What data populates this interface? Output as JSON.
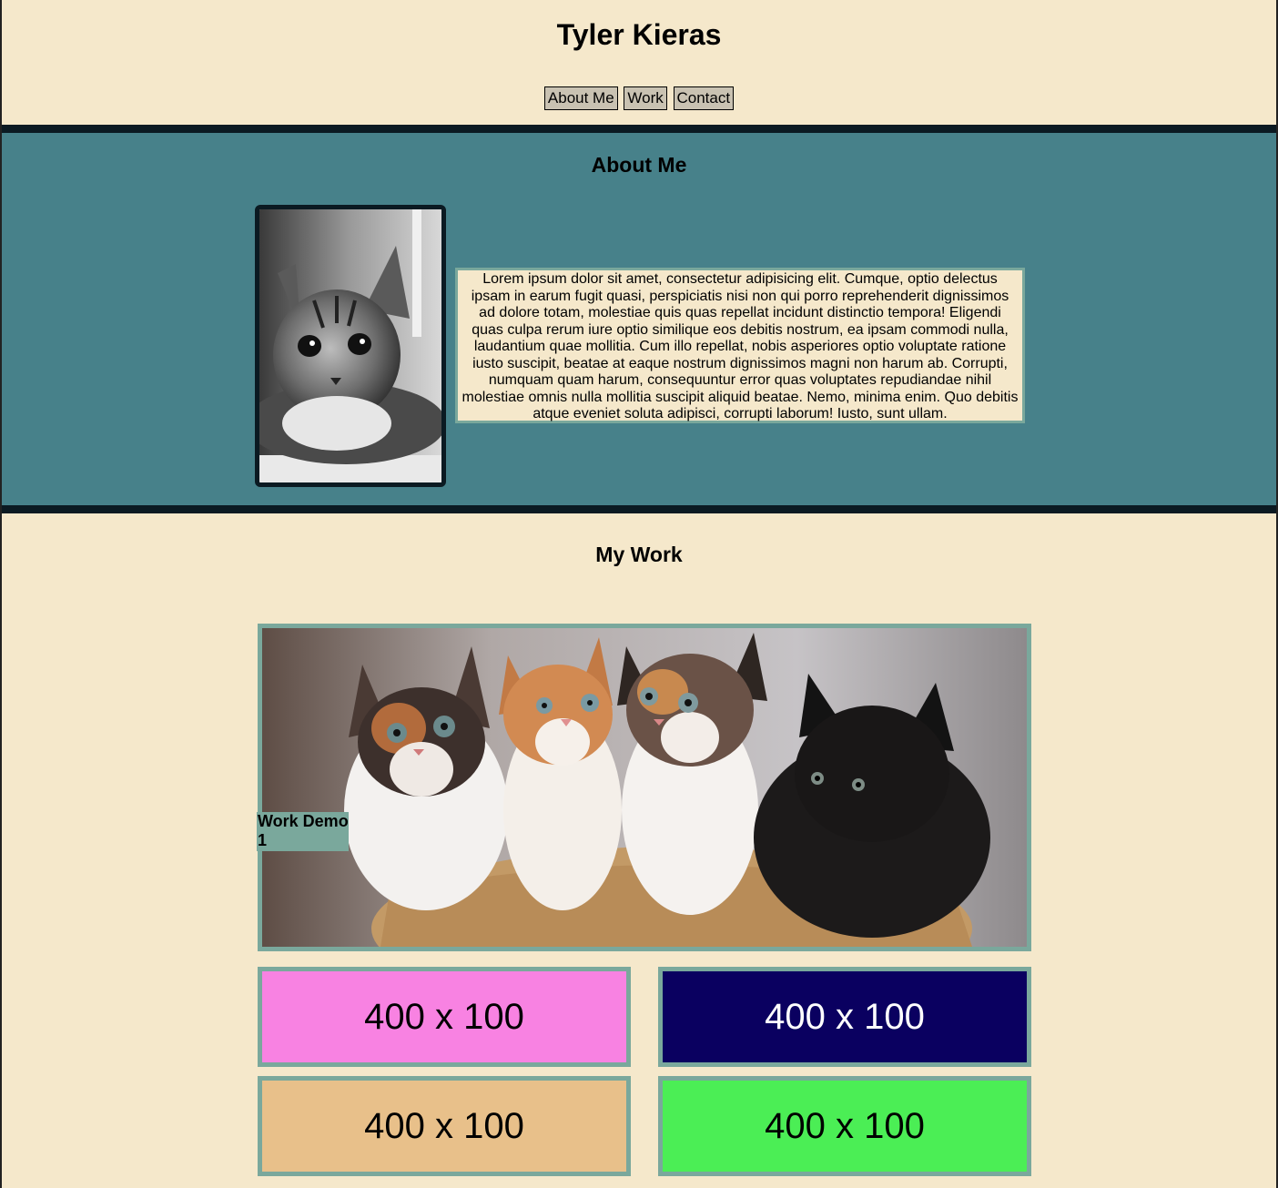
{
  "header": {
    "title": "Tyler Kieras",
    "nav": [
      "About Me",
      "Work",
      "Contact"
    ]
  },
  "about": {
    "heading": "About Me",
    "photo_alt": "Black and white kitten",
    "text": "Lorem ipsum dolor sit amet, consectetur adipisicing elit. Cumque, optio delectus ipsam in earum fugit quasi, perspiciatis nisi non qui porro reprehenderit dignissimos ad dolore totam, molestiae quis quas repellat incidunt distinctio tempora! Eligendi quas culpa rerum iure optio similique eos debitis nostrum, ea ipsam commodi nulla, laudantium quae mollitia. Cum illo repellat, nobis asperiores optio voluptate ratione iusto suscipit, beatae at eaque nostrum dignissimos magni non harum ab. Corrupti, numquam quam harum, consequuntur error quas voluptates repudiandae nihil molestiae omnis nulla mollitia suscipit aliquid beatae. Nemo, minima enim. Quo debitis atque eveniet soluta adipisci, corrupti laborum! Iusto, sunt ullam."
  },
  "work": {
    "heading": "My Work",
    "feature_label": "Work Demo 1",
    "feature_alt": "Four kittens in a basket",
    "tiles": [
      {
        "label": "400 x 100",
        "bg": "#f882e2",
        "fg": "#000000"
      },
      {
        "label": "400 x 100",
        "bg": "#0a0060",
        "fg": "#ffffff"
      },
      {
        "label": "400 x 100",
        "bg": "#e8c08a",
        "fg": "#000000"
      },
      {
        "label": "400 x 100",
        "bg": "#4bee55",
        "fg": "#000000"
      }
    ]
  },
  "colors": {
    "page_bg": "#f5e8cb",
    "about_bg": "#47818a",
    "divider": "#0b1a22",
    "accent_border": "#7aa89c"
  }
}
